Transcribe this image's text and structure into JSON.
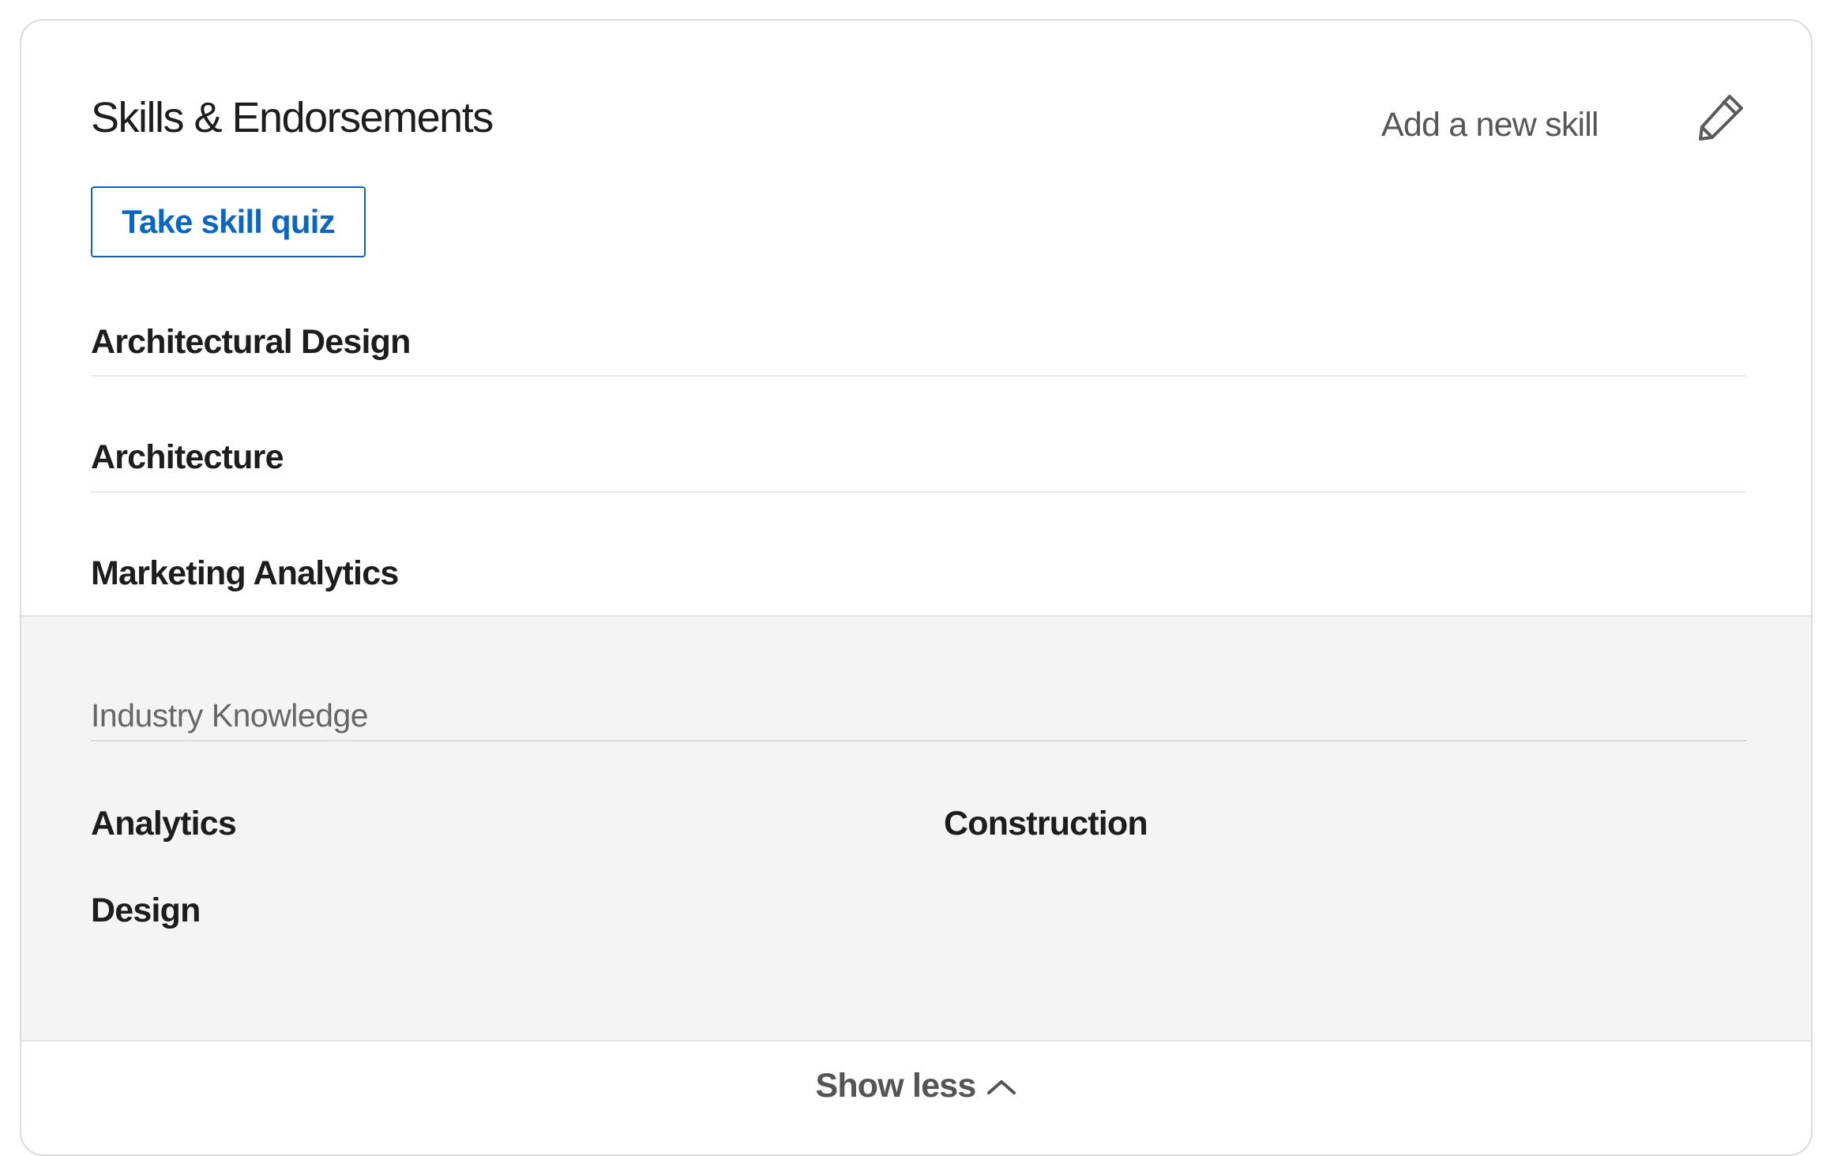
{
  "header": {
    "title": "Skills & Endorsements",
    "add_skill_label": "Add a new skill",
    "edit_icon": "pencil-icon"
  },
  "quiz": {
    "label": "Take skill quiz"
  },
  "top_skills": [
    {
      "label": "Architectural Design"
    },
    {
      "label": "Architecture"
    },
    {
      "label": "Marketing Analytics"
    }
  ],
  "industry_knowledge": {
    "label": "Industry Knowledge",
    "skills": [
      {
        "label": "Analytics"
      },
      {
        "label": "Construction"
      },
      {
        "label": "Design"
      }
    ]
  },
  "footer": {
    "toggle_label": "Show less",
    "toggle_icon": "chevron-up-icon"
  },
  "colors": {
    "accent": "#0a66c2",
    "section_background": "#f4f4f4",
    "divider": "#ebebeb",
    "muted_text": "#676767"
  }
}
